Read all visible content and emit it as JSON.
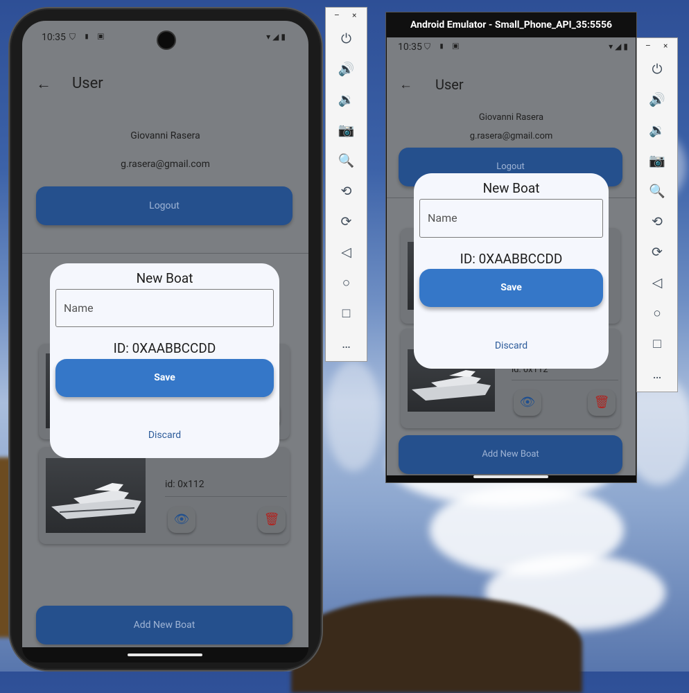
{
  "left_phone": {
    "status": {
      "time": "10:35",
      "left_icons": "⛉ ▮ ▣",
      "right_icons": "▾◢▮"
    },
    "appbar": {
      "back_icon": "arrow-left-icon",
      "title": "User"
    },
    "profile": {
      "name": "Giovanni Rasera",
      "email": "g.rasera@gmail.com"
    },
    "logout_label": "Logout",
    "boat_card": {
      "id_text": "id: 0x112",
      "view_icon": "eye-icon",
      "delete_icon": "trash-icon"
    },
    "add_boat_label": "Add New Boat",
    "dialog": {
      "title": "New Boat",
      "name_placeholder": "Name",
      "id_text": "ID: 0XAABBCCDD",
      "save_label": "Save",
      "discard_label": "Discard"
    }
  },
  "left_toolbar": {
    "minimize": "–",
    "close": "×",
    "items": [
      "power-icon",
      "volume-up-icon",
      "volume-down-icon",
      "camera-icon",
      "zoom-icon",
      "rotate-left-icon",
      "rotate-right-icon",
      "back-icon",
      "home-icon",
      "overview-icon",
      "more-icon"
    ]
  },
  "emulator": {
    "window_title": "Android Emulator - Small_Phone_API_35:5556",
    "status": {
      "time": "10:35"
    },
    "appbar": {
      "title": "User"
    },
    "profile": {
      "name": "Giovanni Rasera",
      "email": "g.rasera@gmail.com"
    },
    "logout_label": "Logout",
    "boat_card": {
      "id_text": "id: 0x112"
    },
    "add_boat_label": "Add New Boat",
    "dialog": {
      "title": "New Boat",
      "name_placeholder": "Name",
      "id_text": "ID: 0XAABBCCDD",
      "save_label": "Save",
      "discard_label": "Discard"
    }
  },
  "right_toolbar": {
    "minimize": "–",
    "close": "×"
  }
}
